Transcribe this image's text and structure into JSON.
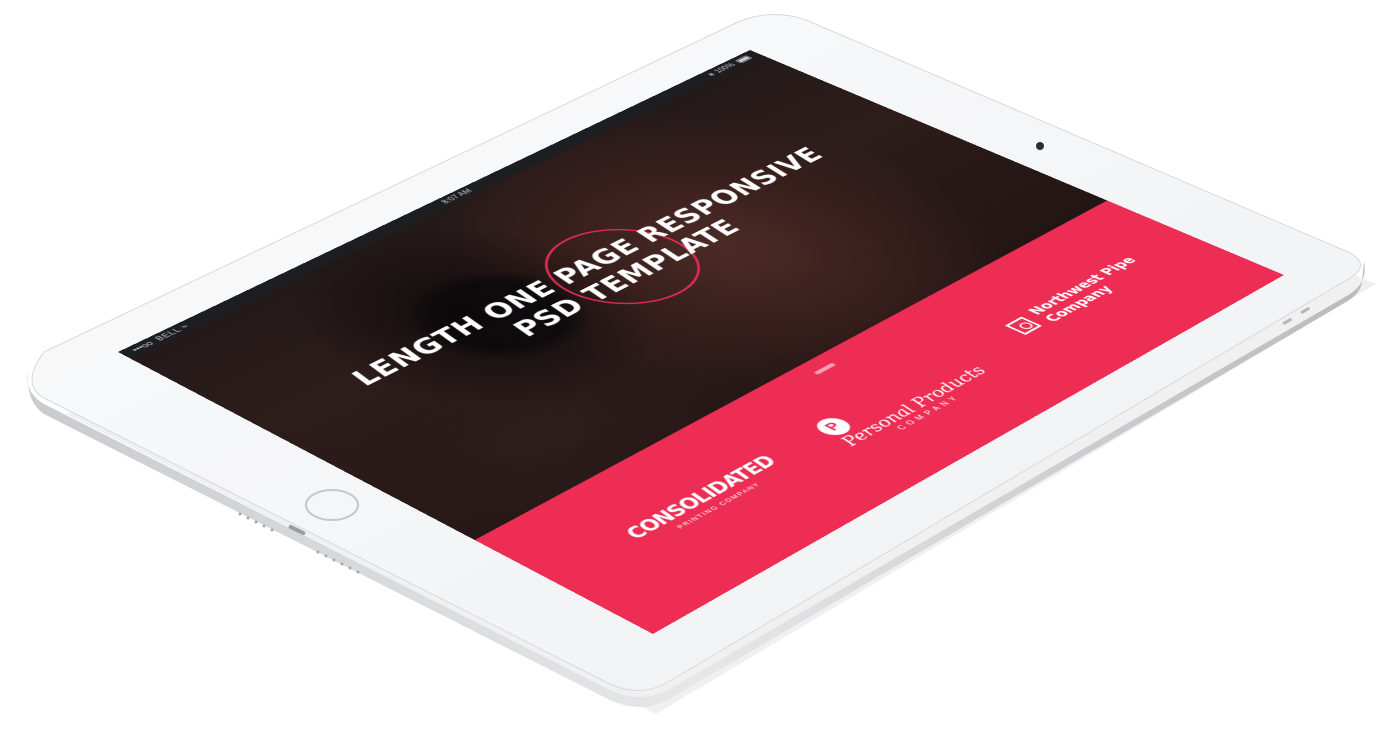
{
  "status_bar": {
    "carrier_dots": "•••oo",
    "carrier": "BELL",
    "wifi_icon": "wifi-icon",
    "time": "8:07 AM",
    "battery_level": "100%",
    "battery_icon": "battery-icon"
  },
  "hero": {
    "title_line1": "Length One Page Responsive",
    "title_line2": "PSD Template",
    "accent_color": "#ee2d55"
  },
  "clients": {
    "consolidated": {
      "name": "CONSOLIDATED",
      "sub": "PRINTING COMPANY"
    },
    "personal": {
      "mark": "P",
      "name": "Personal Products",
      "sub": "COMPANY"
    },
    "northwest": {
      "line1": "Northwest Pipe",
      "line2": "Company"
    },
    "background_color": "#ee2d55"
  },
  "device": {
    "home_button_icon": "home-button-icon",
    "camera_icon": "camera-icon"
  }
}
